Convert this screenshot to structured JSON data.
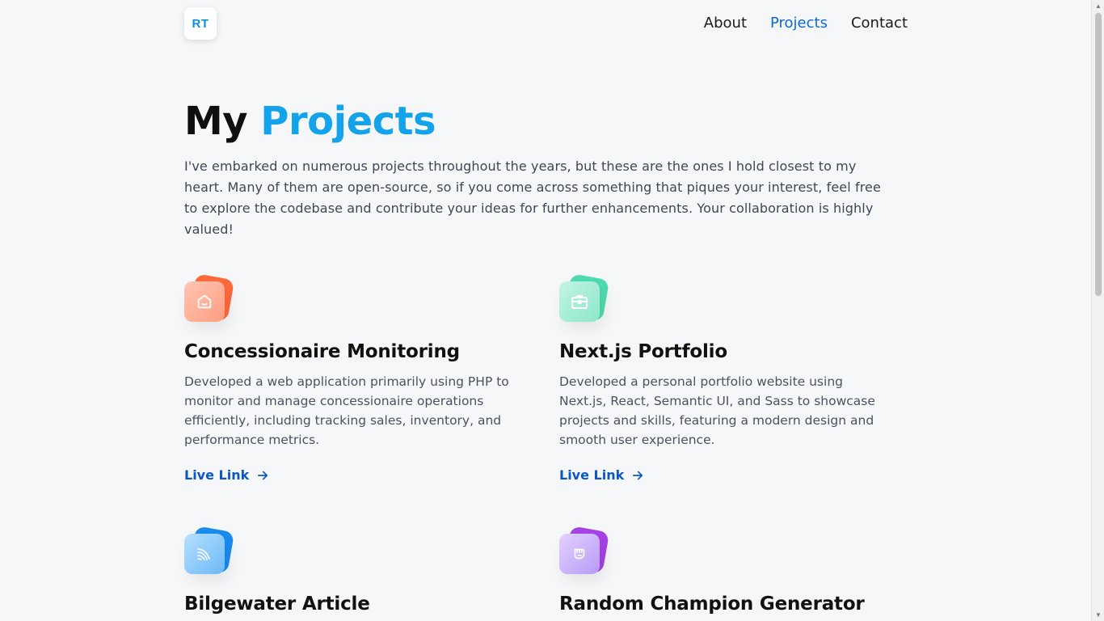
{
  "header": {
    "logo_text": "RT",
    "nav": [
      {
        "label": "About",
        "active": false
      },
      {
        "label": "Projects",
        "active": true
      },
      {
        "label": "Contact",
        "active": false
      }
    ]
  },
  "hero": {
    "title_plain": "My",
    "title_accent": "Projects",
    "intro": "I've embarked on numerous projects throughout the years, but these are the ones I hold closest to my heart. Many of them are open-source, so if you come across something that piques your interest, feel free to explore the codebase and contribute your ideas for further enhancements. Your collaboration is highly valued!"
  },
  "projects": [
    {
      "title": "Concessionaire Monitoring",
      "description": "Developed a web application primarily using PHP to monitor and manage concessionaire operations efficiently, including tracking sales, inventory, and performance metrics.",
      "link_label": "Live Link",
      "icon": "home-icon",
      "color_back": "#ff6a3d",
      "color_front": "#ffb29b"
    },
    {
      "title": "Next.js Portfolio",
      "description": "Developed a personal portfolio website using Next.js, React, Semantic UI, and Sass to showcase projects and skills, featuring a modern design and smooth user experience.",
      "link_label": "Live Link",
      "icon": "briefcase-icon",
      "color_back": "#4fdcb0",
      "color_front": "#a6efd8"
    },
    {
      "title": "Bilgewater Article",
      "description": "",
      "link_label": "",
      "icon": "wave-icon",
      "color_back": "#1a8cf0",
      "color_front": "#8fccff"
    },
    {
      "title": "Random Champion Generator",
      "description": "",
      "link_label": "",
      "icon": "fist-icon",
      "color_back": "#a742e8",
      "color_front": "#d3b4fb"
    }
  ]
}
